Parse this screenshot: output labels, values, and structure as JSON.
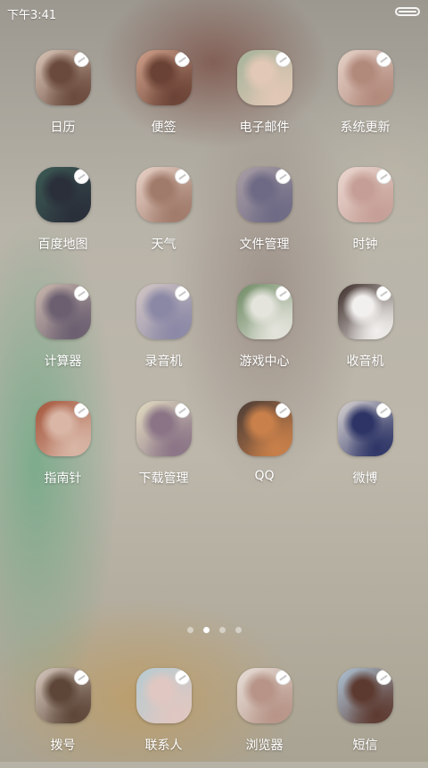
{
  "status_bar": {
    "time": "下午3:41"
  },
  "apps": [
    {
      "label": "日历",
      "colors": [
        "#d9c6b8",
        "#6a4a3c"
      ]
    },
    {
      "label": "便签",
      "colors": [
        "#cfa08a",
        "#6b4336"
      ]
    },
    {
      "label": "电子邮件",
      "colors": [
        "#a6b39a",
        "#e2c8b6"
      ]
    },
    {
      "label": "系统更新",
      "colors": [
        "#e6d2c8",
        "#b28a7c"
      ]
    },
    {
      "label": "百度地图",
      "colors": [
        "#3c5a54",
        "#2a2f3a"
      ]
    },
    {
      "label": "天气",
      "colors": [
        "#e8d2c7",
        "#a07a6a"
      ]
    },
    {
      "label": "文件管理",
      "colors": [
        "#a99ea5",
        "#6e6a85"
      ]
    },
    {
      "label": "时钟",
      "colors": [
        "#ead7cf",
        "#c59f97"
      ]
    },
    {
      "label": "计算器",
      "colors": [
        "#c9b6ad",
        "#6b5f70"
      ]
    },
    {
      "label": "录音机",
      "colors": [
        "#d2c7c5",
        "#8b88a6"
      ]
    },
    {
      "label": "游戏中心",
      "colors": [
        "#6e8a63",
        "#e4e4dc"
      ]
    },
    {
      "label": "收音机",
      "colors": [
        "#3a2a26",
        "#f2f0ee"
      ]
    },
    {
      "label": "指南针",
      "colors": [
        "#a4553a",
        "#d9b6a6"
      ]
    },
    {
      "label": "下载管理",
      "colors": [
        "#e3dcc1",
        "#8a7486"
      ]
    },
    {
      "label": "QQ",
      "colors": [
        "#4a3b35",
        "#c9804a"
      ]
    },
    {
      "label": "微博",
      "colors": [
        "#d9d4d3",
        "#2e3566"
      ]
    }
  ],
  "pager": {
    "count": 4,
    "active": 1
  },
  "dock": [
    {
      "label": "拨号",
      "colors": [
        "#d6c8bd",
        "#5d4638"
      ]
    },
    {
      "label": "联系人",
      "colors": [
        "#b7cbd1",
        "#e0c7c1"
      ]
    },
    {
      "label": "浏览器",
      "colors": [
        "#e7dfd8",
        "#b79487"
      ]
    },
    {
      "label": "短信",
      "colors": [
        "#aec4d6",
        "#5d3a30"
      ]
    }
  ]
}
